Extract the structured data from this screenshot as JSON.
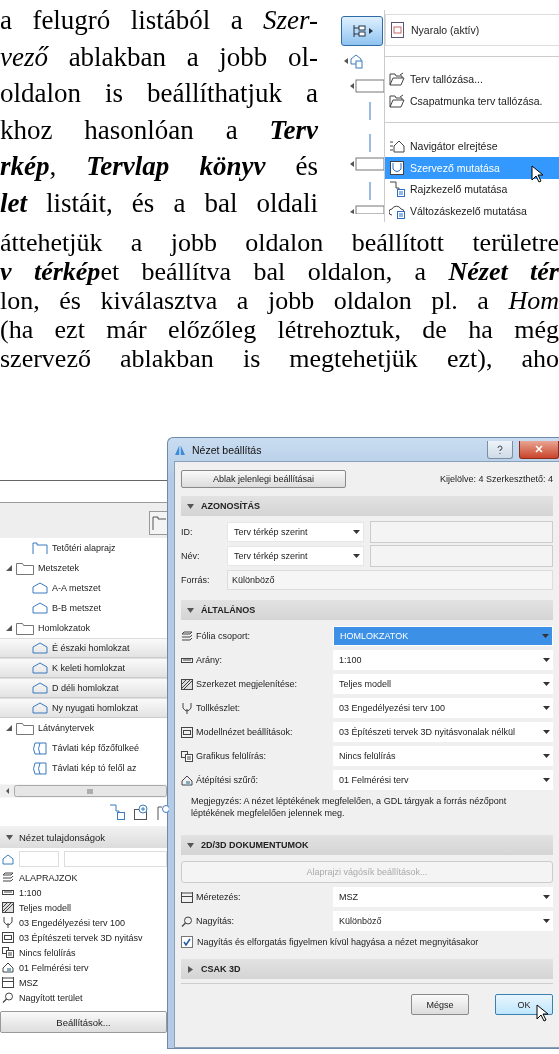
{
  "text_top": [
    "a felugró listából a *Szer-*",
    "*vező* ablakban a jobb ol-",
    "oldalon is beállíthatjuk a",
    "khoz hasonlóan a **Terv**",
    "**rkép**, **Tervlap könyv** és",
    "**let** listáit, és a bal oldali"
  ],
  "menu": {
    "items": [
      {
        "kind": "project",
        "label": "Nyaralo (aktív)",
        "selected": false
      },
      {
        "kind": "separator"
      },
      {
        "kind": "browse",
        "label": "Terv tallózása...",
        "selected": false
      },
      {
        "kind": "teamwork",
        "label": "Csapatmunka terv tallózása.",
        "selected": false
      },
      {
        "kind": "separator"
      },
      {
        "kind": "navigator",
        "label": "Navigátor elrejtése",
        "selected": false
      },
      {
        "kind": "organizer",
        "label": "Szervező mutatása",
        "selected": true
      },
      {
        "kind": "drawing",
        "label": "Rajzkezelő mutatása",
        "selected": false
      },
      {
        "kind": "changes",
        "label": "Változáskezelő mutatása",
        "selected": false
      }
    ]
  },
  "text_bottom": [
    "áttehetjük a jobb oldalon beállított területre",
    "**v térkép**et beállítva bal oldalon, a **Nézet tér**",
    "lon, és kiválasztva a jobb oldalon pl. a *Hom*",
    "(ha ezt már előzőleg létrehoztuk, de ha még",
    "szervező ablakban is megtehetjük ezt), aho"
  ],
  "navigator": {
    "tree": [
      {
        "kind": "plan",
        "label": "Tetőtéri alaprajz",
        "selected": false
      },
      {
        "kind": "folder",
        "label": "Metszetek",
        "expanded": true,
        "selected": false,
        "children": [
          {
            "kind": "section",
            "label": "A-A metszet",
            "selected": false
          },
          {
            "kind": "section",
            "label": "B-B metszet",
            "selected": false
          }
        ]
      },
      {
        "kind": "folder",
        "label": "Homlokzatok",
        "expanded": true,
        "selected": false,
        "children": [
          {
            "kind": "section",
            "label": "É északi homlokzat",
            "selected": true
          },
          {
            "kind": "section",
            "label": "K keleti homlokzat",
            "selected": true
          },
          {
            "kind": "section",
            "label": "D déli homlokzat",
            "selected": true
          },
          {
            "kind": "section",
            "label": "Ny nyugati homlokzat",
            "selected": true
          }
        ]
      },
      {
        "kind": "folder",
        "label": "Látványtervek",
        "expanded": true,
        "selected": false,
        "children": [
          {
            "kind": "camera",
            "label": "Távlati kép főzőfülkeé",
            "selected": false
          },
          {
            "kind": "camera",
            "label": "Távlati kép tó felől az",
            "selected": false
          }
        ]
      }
    ],
    "properties": {
      "title": "Nézet tulajdonságok",
      "expanded": true,
      "rows": [
        {
          "kind": "id"
        },
        {
          "kind": "layer",
          "value": "ALAPRAJZOK"
        },
        {
          "kind": "scale",
          "value": "1:100"
        },
        {
          "kind": "structure",
          "value": "Teljes modell"
        },
        {
          "kind": "pen",
          "value": "03 Engedélyezési terv 100"
        },
        {
          "kind": "modelview",
          "value": "03 Építészeti tervek 3D nyitásv"
        },
        {
          "kind": "override",
          "value": "Nincs felülírás"
        },
        {
          "kind": "renovation",
          "value": "01 Felmérési terv"
        },
        {
          "kind": "dimension",
          "value": "MSZ"
        },
        {
          "kind": "zoom",
          "value": "Nagyított terület"
        }
      ]
    },
    "button": "Beállítások..."
  },
  "dialog": {
    "title": "Nézet beállítás",
    "top_button": "Ablak jelenlegi beállításai",
    "selection_info": "Kijelölve: 4 Szerkeszthető: 4",
    "sections": [
      {
        "title": "AZONOSÍTÁS",
        "expanded": true,
        "rows": [
          {
            "kind": "combo_field",
            "label": "ID:",
            "value": "Terv térkép szerint"
          },
          {
            "kind": "combo_field",
            "label": "Név:",
            "value": "Terv térkép szerint"
          },
          {
            "kind": "readonly",
            "label": "Forrás:",
            "value": "Különböző"
          }
        ]
      },
      {
        "title": "ÁLTALÁNOS",
        "expanded": true,
        "rows": [
          {
            "kind": "layer",
            "label": "Fólia csoport:",
            "value": "HOMLOKZATOK",
            "focused": true
          },
          {
            "kind": "scale",
            "label": "Arány:",
            "value": "1:100",
            "focused": false
          },
          {
            "kind": "structure",
            "label": "Szerkezet megjelenítése:",
            "value": "Teljes modell",
            "focused": false
          },
          {
            "kind": "pen",
            "label": "Tollkészlet:",
            "value": "03 Engedélyezési terv 100",
            "focused": false
          },
          {
            "kind": "modelview",
            "label": "Modellnézet beállítások:",
            "value": "03 Építészeti tervek 3D nyitásvonalak nélkül",
            "focused": false
          },
          {
            "kind": "override",
            "label": "Grafikus felülírás:",
            "value": "Nincs felülírás",
            "focused": false
          },
          {
            "kind": "renovation",
            "label": "Átépítési szűrő:",
            "value": "01 Felmérési terv",
            "focused": false
          },
          {
            "kind": "note",
            "text": "Megjegyzés: A nézet léptékének megfelelően, a GDL tárgyak a forrás nézőpont léptékének megfelelően jelennek meg."
          }
        ]
      },
      {
        "title": "2D/3D DOKUMENTUMOK",
        "expanded": true,
        "rows": [
          {
            "kind": "button",
            "label": "Alaprajzi vágósík beállítások...",
            "disabled": true
          },
          {
            "kind": "dimension",
            "label": "Méretezés:",
            "value": "MSZ",
            "focused": false
          },
          {
            "kind": "zoom",
            "label": "Nagyítás:",
            "value": "Különböző",
            "focused": false
          },
          {
            "kind": "checkbox",
            "label": "Nagyítás és elforgatás figyelmen kívül hagyása a nézet megnyitásakor",
            "checked": true
          }
        ]
      },
      {
        "title": "CSAK 3D",
        "expanded": false
      }
    ],
    "buttons": [
      {
        "label": "Mégse",
        "default": false
      },
      {
        "label": "OK",
        "default": true
      }
    ]
  }
}
